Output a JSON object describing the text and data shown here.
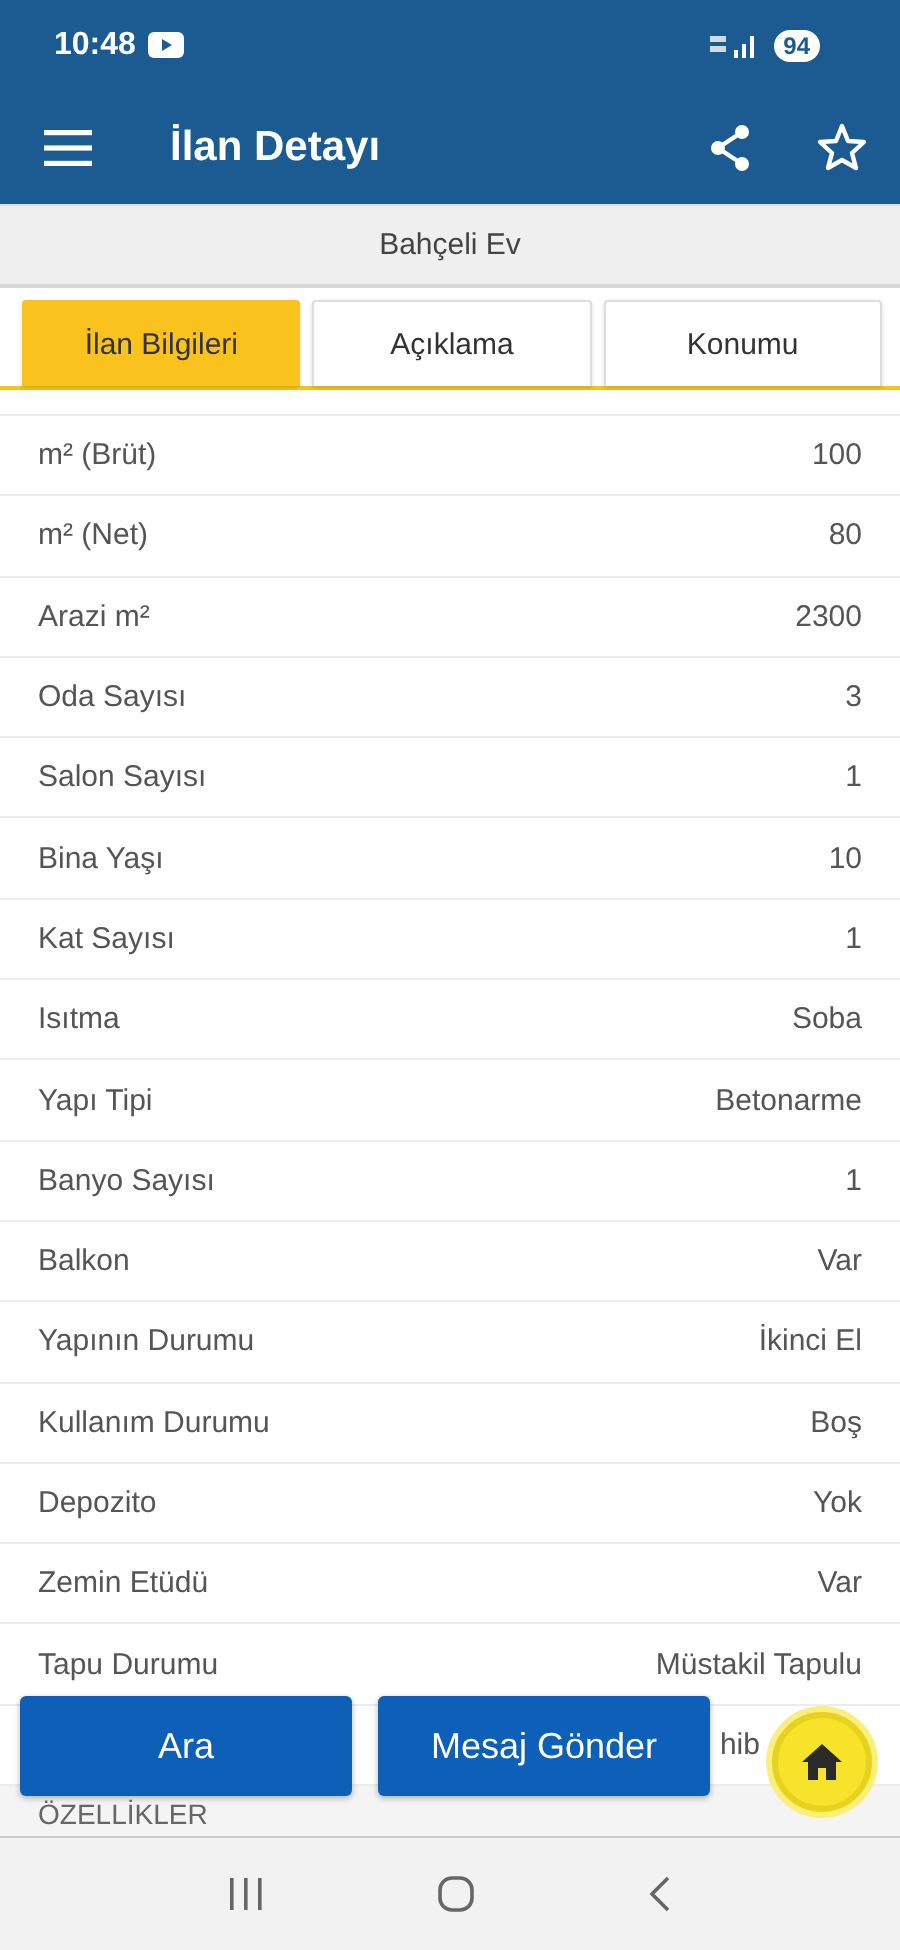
{
  "status_bar": {
    "time": "10:48",
    "battery": "94"
  },
  "app_bar": {
    "title": "İlan Detayı"
  },
  "subtitle": "Bahçeli Ev",
  "tabs": [
    {
      "label": "İlan Bilgileri",
      "selected": true
    },
    {
      "label": "Açıklama",
      "selected": false
    },
    {
      "label": "Konumu",
      "selected": false
    }
  ],
  "details": [
    {
      "label": "m² (Brüt)",
      "value": "100"
    },
    {
      "label": "m² (Net)",
      "value": "80"
    },
    {
      "label": "Arazi m²",
      "value": "2300"
    },
    {
      "label": "Oda Sayısı",
      "value": "3"
    },
    {
      "label": "Salon Sayısı",
      "value": "1"
    },
    {
      "label": "Bina Yaşı",
      "value": "10"
    },
    {
      "label": "Kat Sayısı",
      "value": "1"
    },
    {
      "label": "Isıtma",
      "value": "Soba"
    },
    {
      "label": "Yapı Tipi",
      "value": "Betonarme"
    },
    {
      "label": "Banyo Sayısı",
      "value": "1"
    },
    {
      "label": "Balkon",
      "value": "Var"
    },
    {
      "label": "Yapının Durumu",
      "value": "İkinci El"
    },
    {
      "label": "Kullanım Durumu",
      "value": "Boş"
    },
    {
      "label": "Depozito",
      "value": "Yok"
    },
    {
      "label": "Zemin Etüdü",
      "value": "Var"
    },
    {
      "label": "Tapu Durumu",
      "value": "Müstakil Tapulu"
    }
  ],
  "covered_row_value": "hib",
  "section_header": "ÖZELLİKLER",
  "buttons": [
    {
      "label": "Ara"
    },
    {
      "label": "Mesaj Gönder"
    }
  ]
}
